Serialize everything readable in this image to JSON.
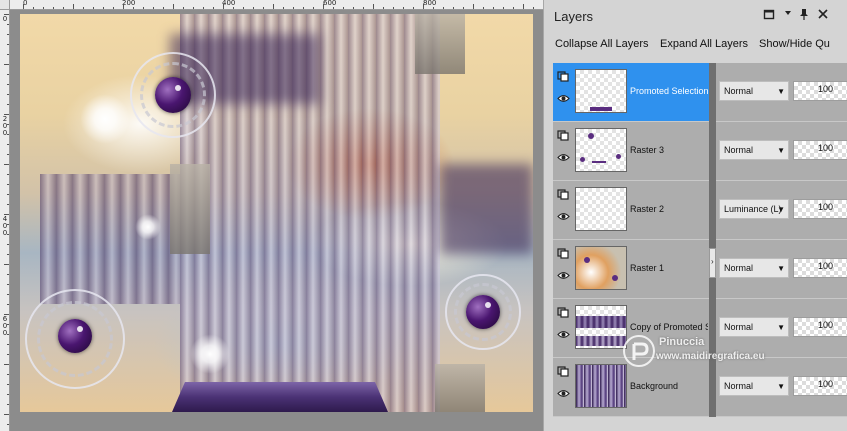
{
  "canvas": {
    "ruler_h_labels": [
      "0",
      "200",
      "400",
      "600",
      "800"
    ],
    "ruler_v_labels": [
      "0",
      "200",
      "400",
      "600"
    ]
  },
  "panel": {
    "title": "Layers",
    "title_buttons": {
      "restore_icon": "restore-window-icon",
      "dropdown_icon": "chevron-down-icon",
      "pin_icon": "pin-icon",
      "close_icon": "close-icon"
    },
    "toolbar": {
      "collapse_all": "Collapse All Layers",
      "expand_all": "Expand All Layers",
      "show_hide": "Show/Hide Qu"
    },
    "selected_color": "#2f91ee",
    "layers": [
      {
        "name": "Promoted Selection",
        "blend": "Normal",
        "opacity": "100",
        "selected": true,
        "thumb": "promoted-selection"
      },
      {
        "name": "Raster 3",
        "blend": "Normal",
        "opacity": "100",
        "selected": false,
        "thumb": "raster3"
      },
      {
        "name": "Raster 2",
        "blend": "Luminance (L)",
        "opacity": "100",
        "selected": false,
        "thumb": "raster2"
      },
      {
        "name": "Raster 1",
        "blend": "Normal",
        "opacity": "100",
        "selected": false,
        "thumb": "raster1"
      },
      {
        "name": "Copy of Promoted S",
        "blend": "Normal",
        "opacity": "100",
        "selected": false,
        "thumb": "copy-promoted"
      },
      {
        "name": "Background",
        "blend": "Normal",
        "opacity": "100",
        "selected": false,
        "thumb": "background"
      }
    ],
    "divider_arrow": "›"
  },
  "watermark": {
    "name": "Pinuccia",
    "url": "www.maidiregrafica.eu"
  }
}
